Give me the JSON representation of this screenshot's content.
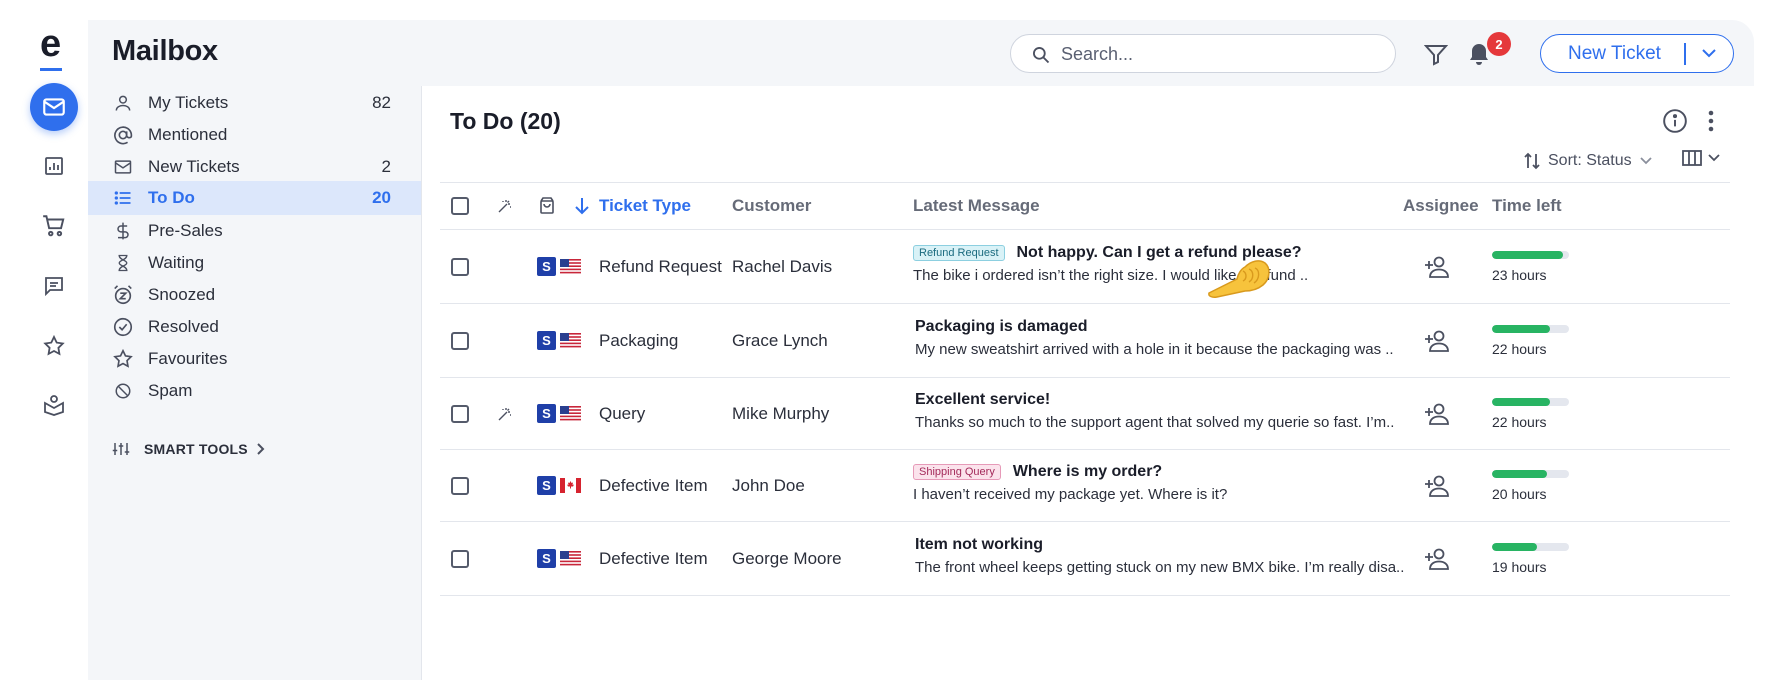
{
  "app": {
    "logo_letter": "e",
    "title": "Mailbox"
  },
  "rail": {
    "items": [
      {
        "icon": "mail-icon",
        "active": true
      },
      {
        "icon": "report-icon"
      },
      {
        "icon": "cart-icon"
      },
      {
        "icon": "chat-icon"
      },
      {
        "icon": "star-icon"
      },
      {
        "icon": "knowledge-icon"
      }
    ]
  },
  "header": {
    "search_placeholder": "Search...",
    "notifications_count": "2",
    "new_ticket_label": "New Ticket"
  },
  "sidebar": {
    "items": [
      {
        "label": "My Tickets",
        "count": "82",
        "icon": "user-icon"
      },
      {
        "label": "Mentioned",
        "count": "",
        "icon": "at-icon"
      },
      {
        "label": "New Tickets",
        "count": "2",
        "icon": "mail-icon"
      },
      {
        "label": "To Do",
        "count": "20",
        "icon": "list-icon",
        "active": true
      },
      {
        "label": "Pre-Sales",
        "count": "",
        "icon": "dollar-icon"
      },
      {
        "label": "Waiting",
        "count": "",
        "icon": "hourglass-icon"
      },
      {
        "label": "Snoozed",
        "count": "",
        "icon": "snooze-icon"
      },
      {
        "label": "Resolved",
        "count": "",
        "icon": "check-circle-icon"
      },
      {
        "label": "Favourites",
        "count": "",
        "icon": "star-icon"
      },
      {
        "label": "Spam",
        "count": "",
        "icon": "block-icon"
      }
    ],
    "smart_tools_label": "SMART TOOLS"
  },
  "main": {
    "list_title": "To Do (20)",
    "sort_label": "Sort: Status",
    "columns": {
      "ticket_type": "Ticket Type",
      "customer": "Customer",
      "latest_message": "Latest Message",
      "assignee": "Assignee",
      "time_left": "Time left"
    },
    "rows": [
      {
        "magic": false,
        "flag": "us",
        "ticket_type": "Refund Request",
        "customer": "Rachel Davis",
        "tag": "Refund Request",
        "tag_kind": "refund",
        "subject": "Not happy. Can I get a refund please?",
        "preview": "The bike i ordered isn’t the right size. I would like a refund ..",
        "time_left": "23 hours",
        "progress": 0.92
      },
      {
        "magic": false,
        "flag": "us",
        "ticket_type": "Packaging",
        "customer": "Grace Lynch",
        "tag": "",
        "tag_kind": "",
        "subject": "Packaging is damaged",
        "preview": "My new sweatshirt arrived with a hole in it because the packaging was ..",
        "time_left": "22 hours",
        "progress": 0.75
      },
      {
        "magic": true,
        "flag": "us",
        "ticket_type": "Query",
        "customer": "Mike Murphy",
        "tag": "",
        "tag_kind": "",
        "subject": "Excellent service!",
        "preview": "Thanks so much to the support agent that solved my querie so fast. I’m..",
        "time_left": "22 hours",
        "progress": 0.75
      },
      {
        "magic": false,
        "flag": "ca",
        "ticket_type": "Defective Item",
        "customer": "John Doe",
        "tag": "Shipping Query",
        "tag_kind": "shipping",
        "subject": "Where is my order?",
        "preview": "I haven’t received my package yet. Where is it?",
        "time_left": "20 hours",
        "progress": 0.71
      },
      {
        "magic": false,
        "flag": "us",
        "ticket_type": "Defective Item",
        "customer": "George Moore",
        "tag": "",
        "tag_kind": "",
        "subject": "Item not working",
        "preview": "The front wheel keeps getting stuck on my new BMX bike. I’m really disa..",
        "time_left": "19 hours",
        "progress": 0.58
      }
    ]
  }
}
